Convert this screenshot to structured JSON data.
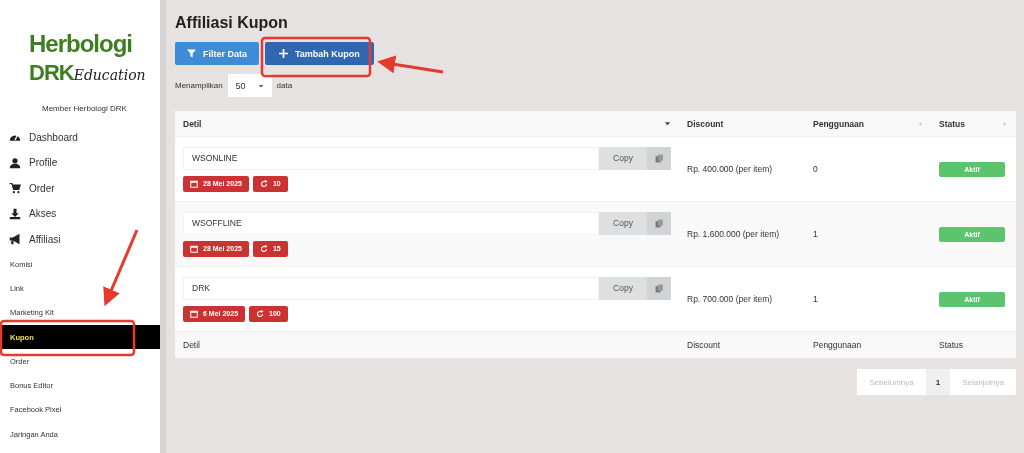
{
  "sidebar": {
    "logo": {
      "line1": "Herbologi",
      "line2": "DRK",
      "script": "Education"
    },
    "member": "Member Herbologi DRK",
    "items": [
      {
        "label": "Dashboard",
        "kind": "main",
        "selected": false
      },
      {
        "label": "Profile",
        "kind": "main",
        "selected": false
      },
      {
        "label": "Order",
        "kind": "main",
        "selected": false
      },
      {
        "label": "Akses",
        "kind": "main",
        "selected": false
      },
      {
        "label": "Affiliasi",
        "kind": "main",
        "selected": false
      },
      {
        "label": "Komisi",
        "kind": "sub",
        "selected": false
      },
      {
        "label": "Link",
        "kind": "sub",
        "selected": false
      },
      {
        "label": "Marketing Kit",
        "kind": "sub",
        "selected": false
      },
      {
        "label": "Kupon",
        "kind": "sub",
        "selected": true
      },
      {
        "label": "Order",
        "kind": "sub",
        "selected": false
      },
      {
        "label": "Bonus Editor",
        "kind": "sub",
        "selected": false
      },
      {
        "label": "Facebook Pixel",
        "kind": "sub",
        "selected": false
      },
      {
        "label": "Jaringan Anda",
        "kind": "sub",
        "selected": false
      }
    ]
  },
  "page": {
    "title": "Affiliasi Kupon",
    "buttons": [
      {
        "label": "Filter Data",
        "kind": "filter"
      },
      {
        "label": "Tambah Kupon",
        "kind": "add"
      }
    ],
    "length": {
      "before": "Menampilkan",
      "value": "50",
      "after": "data"
    }
  },
  "table": {
    "columns": [
      {
        "label": "Detil",
        "sortable": true,
        "sorted": true
      },
      {
        "label": "Discount",
        "sortable": false,
        "sorted": false
      },
      {
        "label": "Penggunaan",
        "sortable": true,
        "sorted": false
      },
      {
        "label": "Status",
        "sortable": true,
        "sorted": false
      }
    ],
    "rows": [
      {
        "code": "WSONLINE",
        "copy": "Copy",
        "date": "28 Mei 2025",
        "uses": "10",
        "discount": "Rp. 400.000 (per item)",
        "usage": "0",
        "status": "Aktif",
        "active": true
      },
      {
        "code": "WSOFFLINE",
        "copy": "Copy",
        "date": "28 Mei 2025",
        "uses": "15",
        "discount": "Rp. 1.600.000 (per item)",
        "usage": "1",
        "status": "Aktif",
        "active": true
      },
      {
        "code": "DRK",
        "copy": "Copy",
        "date": "6 Mei 2025",
        "uses": "100",
        "discount": "Rp. 700.000 (per item)",
        "usage": "1",
        "status": "Aktif",
        "active": true
      }
    ],
    "footer": [
      "Detil",
      "Discount",
      "Penggunaan",
      "Status"
    ]
  },
  "pagination": [
    {
      "label": "Sebelumnya",
      "disabled": true,
      "selected": false
    },
    {
      "label": "1",
      "disabled": false,
      "selected": true
    },
    {
      "label": "Selanjutnya",
      "disabled": true,
      "selected": false
    }
  ]
}
